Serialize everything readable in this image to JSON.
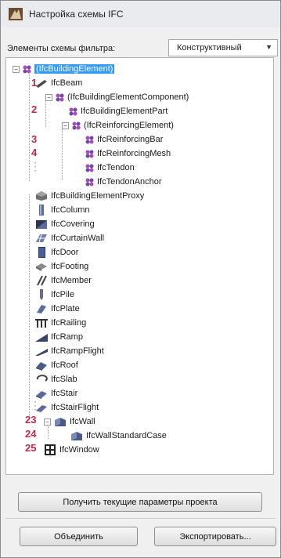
{
  "window": {
    "title": "Настройка схемы IFC"
  },
  "filter": {
    "label": "Элементы схемы фильтра:",
    "value": "Конструктивный"
  },
  "tree": {
    "root": "(IfcBuildingElement)",
    "items": [
      {
        "label": "IfcBeam",
        "icon": "beam-icon"
      },
      {
        "label": "(IfcBuildingElementComponent)",
        "icon": "group-icon"
      },
      {
        "label": "IfcBuildingElementPart",
        "icon": "group-icon"
      },
      {
        "label": "(IfcReinforcingElement)",
        "icon": "group-icon"
      },
      {
        "label": "IfcReinforcingBar",
        "icon": "group-icon"
      },
      {
        "label": "IfcReinforcingMesh",
        "icon": "group-icon"
      },
      {
        "label": "IfcTendon",
        "icon": "group-icon"
      },
      {
        "label": "IfcTendonAnchor",
        "icon": "group-icon"
      },
      {
        "label": "IfcBuildingElementProxy",
        "icon": "proxy-icon"
      },
      {
        "label": "IfcColumn",
        "icon": "column-icon"
      },
      {
        "label": "IfcCovering",
        "icon": "covering-icon"
      },
      {
        "label": "IfcCurtainWall",
        "icon": "curtain-wall-icon"
      },
      {
        "label": "IfcDoor",
        "icon": "door-icon"
      },
      {
        "label": "IfcFooting",
        "icon": "footing-icon"
      },
      {
        "label": "IfcMember",
        "icon": "member-icon"
      },
      {
        "label": "IfcPile",
        "icon": "pile-icon"
      },
      {
        "label": "IfcPlate",
        "icon": "plate-icon"
      },
      {
        "label": "IfcRailing",
        "icon": "railing-icon"
      },
      {
        "label": "IfcRamp",
        "icon": "ramp-icon"
      },
      {
        "label": "IfcRampFlight",
        "icon": "ramp-flight-icon"
      },
      {
        "label": "IfcRoof",
        "icon": "roof-icon"
      },
      {
        "label": "IfcSlab",
        "icon": "slab-icon"
      },
      {
        "label": "IfcStair",
        "icon": "stair-icon"
      },
      {
        "label": "IfcStairFlight",
        "icon": "stair-flight-icon"
      },
      {
        "label": "IfcWall",
        "icon": "wall-icon"
      },
      {
        "label": "IfcWallStandardCase",
        "icon": "wall-icon"
      },
      {
        "label": "IfcWindow",
        "icon": "window-icon"
      }
    ]
  },
  "annotations": {
    "n1": "1",
    "n2": "2",
    "n3": "3",
    "n4": "4",
    "n23": "23",
    "n24": "24",
    "n25": "25"
  },
  "buttons": {
    "get_params": "Получить текущие параметры проекта",
    "merge": "Объединить",
    "export": "Экспортировать..."
  },
  "colors": {
    "selection": "#3399ff",
    "annotation": "#c0294a"
  }
}
